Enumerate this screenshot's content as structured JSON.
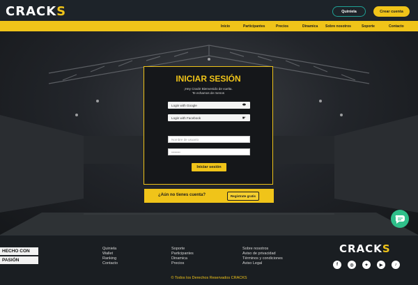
{
  "header": {
    "logo_text": "CRACK",
    "logo_accent": "S",
    "quiniela_button": "Quiniela",
    "crear_cuenta_button": "Crear cuenta"
  },
  "nav": {
    "items": [
      "Inicio",
      "Participantes",
      "Precios",
      "Dinamica",
      "Sobre nosotros",
      "Soporte",
      "Contacto"
    ]
  },
  "login": {
    "title": "INICIAR SESIÓN",
    "subtitle_line1": "¡Hey Crack! Bienvenido de vuelta.",
    "subtitle_line2": "Te echamos de menos",
    "google_label": "Login with Google",
    "google_icon": "google-icon",
    "facebook_label": "Login with Facebook",
    "facebook_icon": "facebook-icon",
    "username_placeholder": "Nombre de usuario",
    "password_value": "••••••••",
    "submit_label": "Iniciar sesión"
  },
  "signup": {
    "question": "¿Aún no tienes cuenta?",
    "button": "Regístrate gratis"
  },
  "footer": {
    "badge_line1": "HECHO CON",
    "badge_line2": "PASIÓN",
    "col1": [
      "Quiniela",
      "Wallet",
      "Ranking",
      "Contacto"
    ],
    "col2": [
      "Soporte",
      "Participantes",
      "Dinamica",
      "Precios"
    ],
    "col3": [
      "Sobre nosotros",
      "Aviso de privacidad",
      "Términos y condiciones",
      "Aviso Legal"
    ],
    "logo_text": "CRACK",
    "logo_accent": "S",
    "social_icons": [
      "facebook-icon",
      "instagram-icon",
      "twitter-icon",
      "youtube-icon",
      "tiktok-icon"
    ],
    "copyright": "© Todos los Derechos Reservados CRACKS"
  },
  "colors": {
    "accent": "#f0c419",
    "teal": "#1ea196",
    "dark": "#1d2329"
  }
}
